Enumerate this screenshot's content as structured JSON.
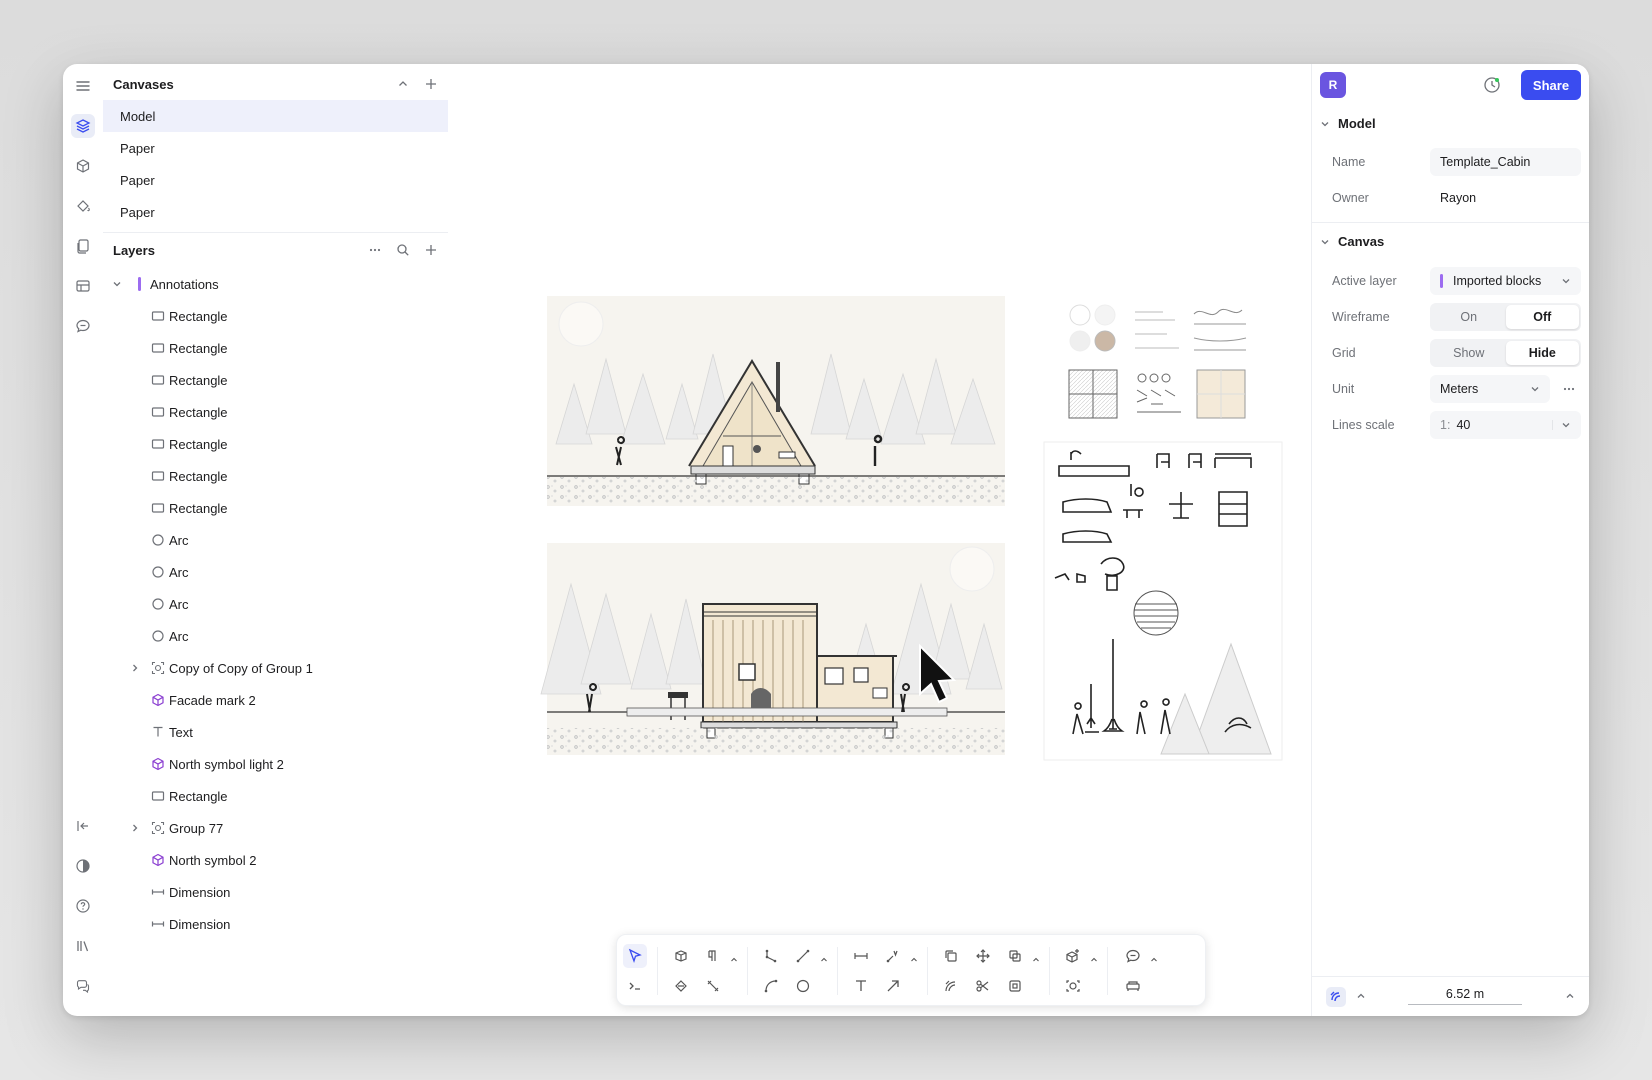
{
  "canvases": {
    "title": "Canvases",
    "items": [
      {
        "label": "Model",
        "selected": true
      },
      {
        "label": "Paper",
        "selected": false
      },
      {
        "label": "Paper",
        "selected": false
      },
      {
        "label": "Paper",
        "selected": false
      }
    ]
  },
  "layers": {
    "title": "Layers",
    "items": [
      {
        "label": "Annotations",
        "icon": "layer-bar-icon",
        "expandable": true,
        "expanded": true,
        "depth": 0
      },
      {
        "label": "Rectangle",
        "icon": "rectangle-icon",
        "depth": 1
      },
      {
        "label": "Rectangle",
        "icon": "rectangle-icon",
        "depth": 1
      },
      {
        "label": "Rectangle",
        "icon": "rectangle-icon",
        "depth": 1
      },
      {
        "label": "Rectangle",
        "icon": "rectangle-icon",
        "depth": 1
      },
      {
        "label": "Rectangle",
        "icon": "rectangle-icon",
        "depth": 1
      },
      {
        "label": "Rectangle",
        "icon": "rectangle-icon",
        "depth": 1
      },
      {
        "label": "Rectangle",
        "icon": "rectangle-icon",
        "depth": 1
      },
      {
        "label": "Arc",
        "icon": "arc-icon",
        "depth": 1
      },
      {
        "label": "Arc",
        "icon": "arc-icon",
        "depth": 1
      },
      {
        "label": "Arc",
        "icon": "arc-icon",
        "depth": 1
      },
      {
        "label": "Arc",
        "icon": "arc-icon",
        "depth": 1
      },
      {
        "label": "Copy of Copy of Group 1",
        "icon": "group-icon",
        "expandable": true,
        "depth": 1
      },
      {
        "label": "Facade mark 2",
        "icon": "component-icon",
        "depth": 1
      },
      {
        "label": "Text",
        "icon": "text-icon",
        "depth": 1
      },
      {
        "label": "North symbol light 2",
        "icon": "component-icon",
        "depth": 1
      },
      {
        "label": "Rectangle",
        "icon": "rectangle-icon",
        "depth": 1
      },
      {
        "label": "Group 77",
        "icon": "group-icon",
        "expandable": true,
        "depth": 1
      },
      {
        "label": "North symbol 2",
        "icon": "component-icon",
        "depth": 1
      },
      {
        "label": "Dimension",
        "icon": "dimension-icon",
        "depth": 1
      },
      {
        "label": "Dimension",
        "icon": "dimension-icon",
        "depth": 1
      }
    ]
  },
  "header": {
    "avatar_initial": "R",
    "share_label": "Share"
  },
  "model": {
    "title": "Model",
    "name_label": "Name",
    "name_value": "Template_Cabin",
    "owner_label": "Owner",
    "owner_value": "Rayon"
  },
  "canvas_props": {
    "title": "Canvas",
    "active_layer_label": "Active layer",
    "active_layer_value": "Imported blocks",
    "wireframe_label": "Wireframe",
    "wireframe_on": "On",
    "wireframe_off": "Off",
    "wireframe_selected": "Off",
    "grid_label": "Grid",
    "grid_show": "Show",
    "grid_hide": "Hide",
    "grid_selected": "Hide",
    "unit_label": "Unit",
    "unit_value": "Meters",
    "lines_scale_label": "Lines scale",
    "lines_scale_prefix": "1:",
    "lines_scale_value": "40"
  },
  "footer": {
    "measure_value": "6.52 m"
  },
  "colors": {
    "accent": "#3a4cf0",
    "avatar": "#6a55e0",
    "component": "#8b3fd1",
    "layer_bar": "#9c6cf0",
    "selection": "#eef0fb"
  }
}
